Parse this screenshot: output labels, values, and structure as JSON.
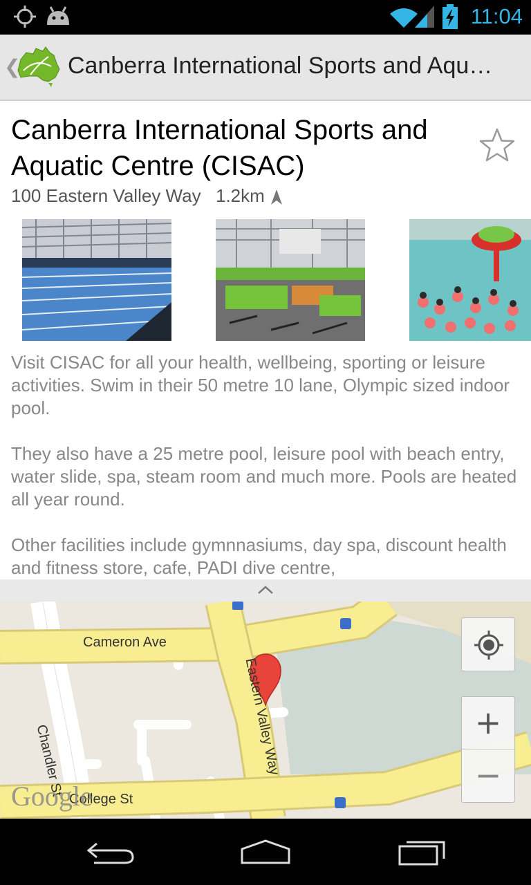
{
  "status_bar": {
    "time": "11:04"
  },
  "action_bar": {
    "title": "Canberra International Sports and Aqu…"
  },
  "place": {
    "title": "Canberra International Sports and Aquatic Centre (CISAC)",
    "address": "100 Eastern Valley Way",
    "distance": "1.2km",
    "description": [
      "Visit CISAC for all your health, wellbeing, sporting or leisure activities. Swim in their 50 metre 10 lane, Olympic sized indoor pool.",
      "They also have a 25 metre pool, leisure pool with beach entry, water slide, spa, steam room and much more. Pools are heated all year round.",
      "Other facilities include gymnnasiums, day spa, discount health and fitness store, cafe, PADI dive centre,"
    ]
  },
  "map": {
    "labels": {
      "cameron": "Cameron Ave",
      "chandler": "Chandler St",
      "eastern": "Eastern Valley Way",
      "college": "College St"
    },
    "google": "Google",
    "zoom_in": "+",
    "zoom_out": "−"
  }
}
